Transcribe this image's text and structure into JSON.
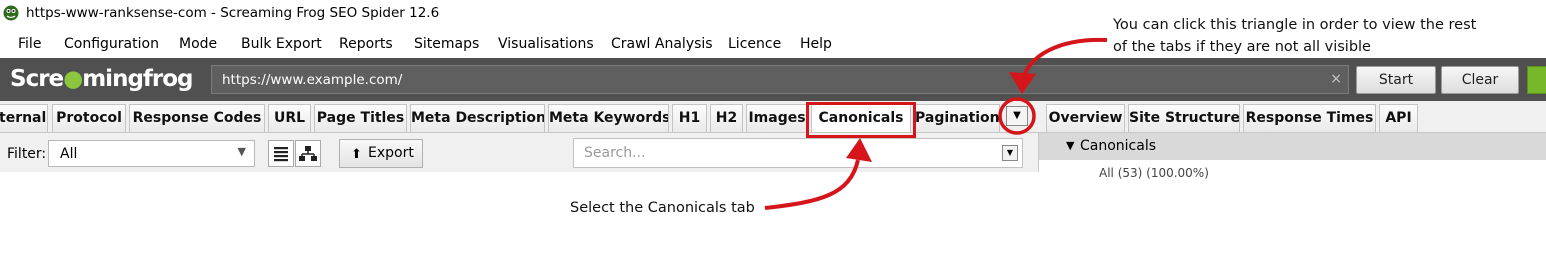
{
  "window": {
    "title": "https-www-ranksense-com - Screaming Frog SEO Spider 12.6"
  },
  "menu": [
    "File",
    "Configuration",
    "Mode",
    "Bulk Export",
    "Reports",
    "Sitemaps",
    "Visualisations",
    "Crawl Analysis",
    "Licence",
    "Help"
  ],
  "toolbar": {
    "logo_left": "Scre",
    "logo_right": "mingfrog",
    "url_value": "https://www.example.com/",
    "clear_glyph": "×",
    "start_label": "Start",
    "clear_label": "Clear",
    "accent": "#76b82a"
  },
  "tabs": [
    "ternal",
    "Protocol",
    "Response Codes",
    "URL",
    "Page Titles",
    "Meta Description",
    "Meta Keywords",
    "H1",
    "H2",
    "Images",
    "Canonicals",
    "Pagination"
  ],
  "active_tab": "Canonicals",
  "right_tabs": [
    "Overview",
    "Site Structure",
    "Response Times",
    "API"
  ],
  "filter": {
    "label": "Filter:",
    "value": "All",
    "export_label": "Export",
    "search_placeholder": "Search..."
  },
  "right_panel": {
    "section_label": "Canonicals",
    "clipped_row": "All (53) (100.00%)"
  },
  "annotations": {
    "triangle_note_line1": "You can click this triangle in order to view the rest",
    "triangle_note_line2": "of the tabs if they are not all visible",
    "canonicals_note": "Select the Canonicals tab",
    "highlight_color": "#d6151a"
  }
}
